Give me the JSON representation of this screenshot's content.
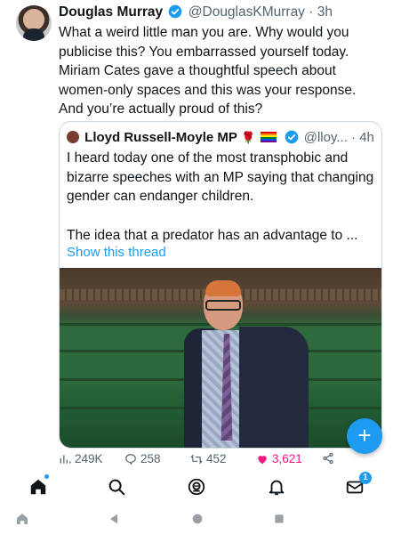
{
  "tweet": {
    "author_name": "Douglas Murray",
    "handle_time": "@DouglasKMurray · 3h",
    "text": "What a weird little man you are. Why would you publicise this? You embarrassed yourself today. Miriam Cates gave a thoughtful speech about women-only spaces and this was your response. And you’re actually proud of this?"
  },
  "quote": {
    "author_name": "Lloyd Russell-Moyle MP",
    "handle_time": "@lloy... · 4h",
    "paragraph1": "I heard today one of the most transphobic and bizarre speeches with an MP saying that changing gender can endanger children.",
    "paragraph2": "The idea that a predator has an advantage to ...",
    "show_thread": "Show this thread"
  },
  "actions": {
    "views": "249K",
    "replies": "258",
    "retweets": "452",
    "likes": "3,621"
  },
  "tabbar": {
    "notifications_badge": "1"
  },
  "colors": {
    "accent": "#1d9bf0",
    "like": "#f91880",
    "muted": "#536471"
  },
  "icons": [
    "verified-badge-icon",
    "rose-icon",
    "rainbow-flag-icon",
    "plus-icon",
    "views-icon",
    "reply-icon",
    "retweet-icon",
    "heart-icon",
    "share-icon",
    "home-icon",
    "search-icon",
    "spaces-icon",
    "bell-icon",
    "mail-icon",
    "recent-apps-icon",
    "back-icon",
    "home-circle-icon",
    "overview-icon"
  ]
}
